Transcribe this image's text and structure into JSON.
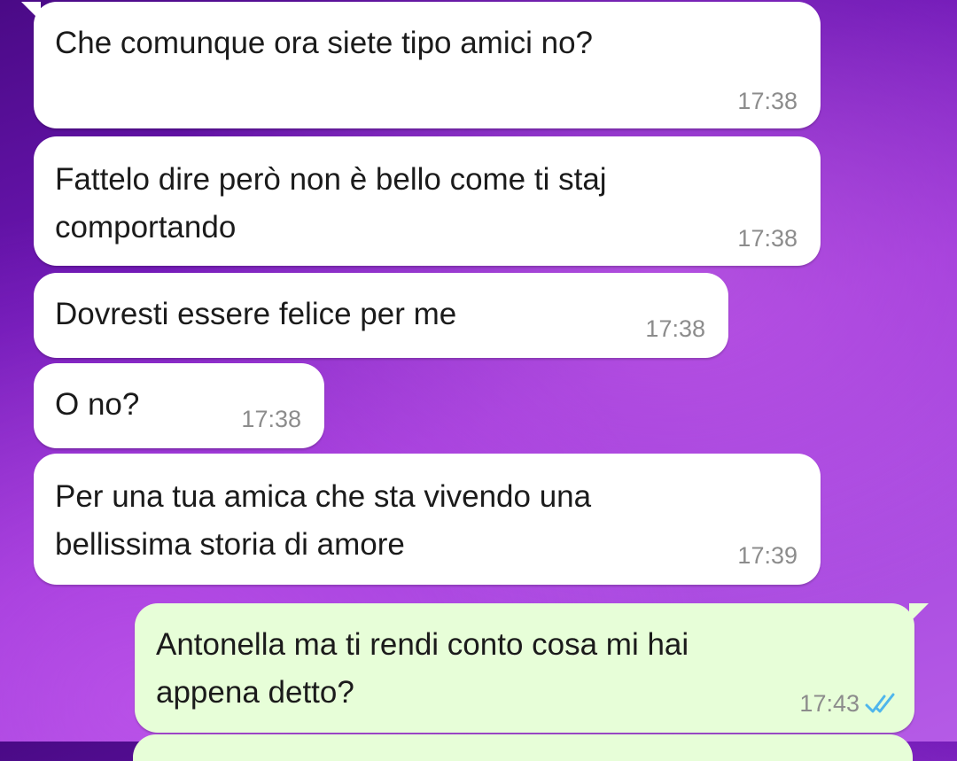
{
  "messages": [
    {
      "direction": "incoming",
      "text": "Che comunque ora siete tipo amici no?",
      "time": "17:38"
    },
    {
      "direction": "incoming",
      "text": "Fattelo dire però non è bello come ti staj\ncomportando",
      "time": "17:38"
    },
    {
      "direction": "incoming",
      "text": "Dovresti essere felice per me",
      "time": "17:38"
    },
    {
      "direction": "incoming",
      "text": "O no?",
      "time": "17:38"
    },
    {
      "direction": "incoming",
      "text": "Per una tua amica che sta vivendo una\nbellissima storia di amore",
      "time": "17:39"
    },
    {
      "direction": "outgoing",
      "text": "Antonella ma ti rendi conto cosa mi hai\nappena detto?",
      "time": "17:43",
      "status": "read",
      "status_icon": "double-check-icon",
      "status_color": "#4fb6ec"
    }
  ],
  "colors": {
    "incoming_bubble": "#ffffff",
    "outgoing_bubble": "#e7fed8",
    "timestamp": "#8c8c8c",
    "read_ticks": "#4fb6ec"
  }
}
